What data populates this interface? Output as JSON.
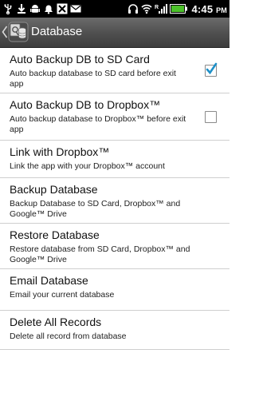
{
  "status_bar": {
    "time": "4:45",
    "time_suffix": "PM",
    "icons": [
      "usb-icon",
      "download-icon",
      "android-debug-icon",
      "bell-icon",
      "notification-x-icon",
      "mail-icon",
      "headset-icon",
      "wifi-icon",
      "signal-icon",
      "battery-icon"
    ]
  },
  "action_bar": {
    "title": "Database"
  },
  "settings": [
    {
      "title": "Auto Backup DB to SD Card",
      "summary": "Auto backup database to SD card before exit app",
      "checkbox": true,
      "checked": true
    },
    {
      "title": "Auto Backup DB to Dropbox™",
      "summary": "Auto backup database to Dropbox™ before exit app",
      "checkbox": true,
      "checked": false
    },
    {
      "title": "Link with Dropbox™",
      "summary": "Link the app with your Dropbox™ account",
      "checkbox": false
    },
    {
      "title": "Backup Database",
      "summary": "Backup Database to SD Card, Dropbox™ and Google™ Drive",
      "checkbox": false
    },
    {
      "title": "Restore Database",
      "summary": "Restore database from SD Card, Dropbox™ and Google™ Drive",
      "checkbox": false
    },
    {
      "title": "Email Database",
      "summary": "Email your current database",
      "checkbox": false
    },
    {
      "title": "Delete All Records",
      "summary": "Delete all record from database",
      "checkbox": false
    }
  ],
  "colors": {
    "check_accent": "#1e90c8",
    "battery_green": "#4cc12a"
  }
}
